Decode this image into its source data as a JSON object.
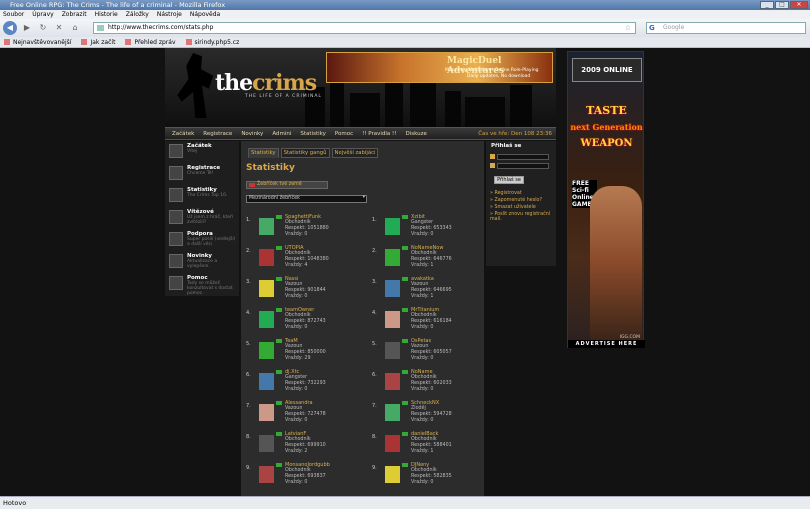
{
  "browser": {
    "title": "Free Online RPG: The Crims - The life of a criminal - Mozilla Firefox",
    "menu": [
      "Soubor",
      "Úpravy",
      "Zobrazit",
      "Historie",
      "Záložky",
      "Nástroje",
      "Nápověda"
    ],
    "url": "http://www.thecrims.com/stats.php",
    "search_placeholder": "Google",
    "bookmarks": [
      "Nejnavštěvovanější",
      "Jak začít",
      "Přehled zpráv",
      "sirindy.php5.cz"
    ],
    "status": "Hotovo"
  },
  "site": {
    "logo_a": "the",
    "logo_b": "crims",
    "logo_sub": "THE LIFE OF A CRIMINAL",
    "ad_title": "MagicDuel Adventures",
    "ad_sub": "Massively Multiplayer Online Role-Playing",
    "ad_sub2": "Daily updates, No download",
    "nav": [
      "Začátek",
      "Registrace",
      "Novinky",
      "Admini",
      "Statistiky",
      "Pomoc",
      "!! Pravidla !!",
      "Diskuze"
    ],
    "time": "Čas ve hře: Den 108 23:36"
  },
  "sidebar": [
    {
      "title": "Začátek",
      "desc": "Vítej"
    },
    {
      "title": "Registrace",
      "desc": "Chceme Tě!"
    },
    {
      "title": "Statistiky",
      "desc": "The Crims Top 10."
    },
    {
      "title": "Vítězové",
      "desc": "Už jsem z hráč, kteří zvítězili?"
    },
    {
      "title": "Podpora",
      "desc": "Super posilí (vedlejší) a další věci"
    },
    {
      "title": "Novinky",
      "desc": "Aktualizace a vylepšení."
    },
    {
      "title": "Pomoc",
      "desc": "Tady se můžeš konzultovat s dostat pomoc."
    }
  ],
  "stats": {
    "tabs": [
      "Statistiky",
      "Statistiky gangů",
      "Nejvěší zabijáci"
    ],
    "title": "Statistiky",
    "flag_btn": "Žebříček tvé země",
    "select": "Mezinárodní žebříček",
    "left": [
      {
        "rank": "1.",
        "name": "SpaghettiFunk",
        "cls": "Obchodník",
        "resp": "Respekt: 1051880",
        "kills": "Vraždy: 0"
      },
      {
        "rank": "2.",
        "name": "UTOPIA",
        "cls": "Obchodník",
        "resp": "Respekt: 1048380",
        "kills": "Vraždy: 4"
      },
      {
        "rank": "3.",
        "name": "Nassi",
        "cls": "Vazoun",
        "resp": "Respekt: 901844",
        "kills": "Vraždy: 0"
      },
      {
        "rank": "4.",
        "name": "teamOwner",
        "cls": "Obchodník",
        "resp": "Respekt: 872743",
        "kills": "Vraždy: 0"
      },
      {
        "rank": "5.",
        "name": "TeaM",
        "cls": "Vazoun",
        "resp": "Respekt: 850000",
        "kills": "Vraždy: 29"
      },
      {
        "rank": "6.",
        "name": "dj.Xtc",
        "cls": "Gangster",
        "resp": "Respekt: 732293",
        "kills": "Vraždy: 0"
      },
      {
        "rank": "7.",
        "name": "Alessandra",
        "cls": "Vazoun",
        "resp": "Respekt: 727478",
        "kills": "Vraždy: 0"
      },
      {
        "rank": "8.",
        "name": "LatvianF",
        "cls": "Obchodník",
        "resp": "Respekt: 699910",
        "kills": "Vraždy: 2"
      },
      {
        "rank": "9.",
        "name": "MonsanoJordgubb",
        "cls": "Obchodník",
        "resp": "Respekt: 693837",
        "kills": "Vraždy: 0"
      }
    ],
    "right": [
      {
        "rank": "1.",
        "name": "Xzibit",
        "cls": "Gangster",
        "resp": "Respekt: 653343",
        "kills": "Vraždy: 0"
      },
      {
        "rank": "2.",
        "name": "NoNameNow",
        "cls": "Obchodník",
        "resp": "Respekt: 646776",
        "kills": "Vraždy: 1"
      },
      {
        "rank": "3.",
        "name": "avakatka",
        "cls": "Vazoun",
        "resp": "Respekt: 646695",
        "kills": "Vraždy: 1"
      },
      {
        "rank": "4.",
        "name": "MrTitanium",
        "cls": "Obchodník",
        "resp": "Respekt: 616184",
        "kills": "Vraždy: 0"
      },
      {
        "rank": "5.",
        "name": "OsPetas",
        "cls": "Vazoun",
        "resp": "Respekt: 605057",
        "kills": "Vraždy: 0"
      },
      {
        "rank": "6.",
        "name": "NoName",
        "cls": "Obchodník",
        "resp": "Respekt: 602033",
        "kills": "Vraždy: 0"
      },
      {
        "rank": "7.",
        "name": "SchneckNX",
        "cls": "Zloděj",
        "resp": "Respekt: 594728",
        "kills": "Vraždy: 0"
      },
      {
        "rank": "8.",
        "name": "danielBack",
        "cls": "Obchodník",
        "resp": "Respekt: 588401",
        "kills": "Vraždy: 1"
      },
      {
        "rank": "9.",
        "name": "DJNeny",
        "cls": "Obchodník",
        "resp": "Respekt: 582835",
        "kills": "Vraždy: 0"
      }
    ]
  },
  "login": {
    "title": "Přihlaš se",
    "button": "Přihlaš se",
    "links": [
      "» Registrovat",
      "» Zapomenuté heslo?",
      "» Smazat uživatele",
      "» Poslit znovu registrační mail."
    ]
  },
  "skyad": {
    "year": "2009 ONLINE",
    "taste": "TASTE",
    "next": "next Generation",
    "weapon": "WEAPON",
    "free": "FREE Sci-fi Online GAME",
    "igg": "IGG.COM",
    "advertise": "ADVERTISE HERE"
  }
}
